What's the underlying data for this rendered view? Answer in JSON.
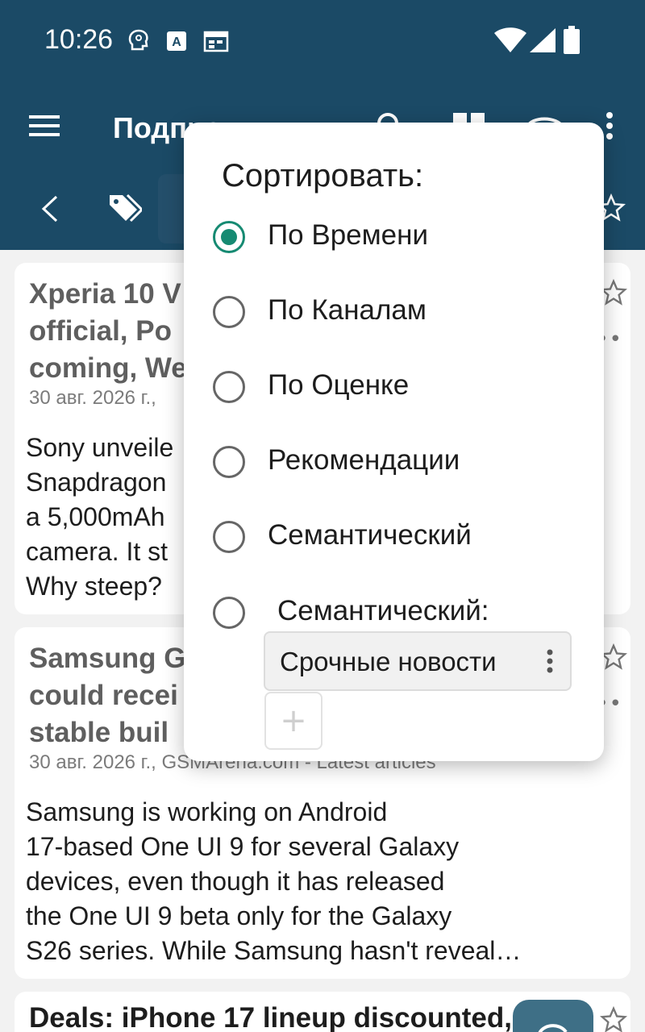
{
  "status_bar": {
    "time": "10:26"
  },
  "toolbar": {
    "title": "Подписки"
  },
  "colors": {
    "header_bg": "#1b4a66",
    "accent": "#168a72",
    "card_bg": "#ffffff"
  },
  "cards": [
    {
      "title_lines": [
        "Xperia 10 V",
        "official, Po",
        "coming, We"
      ],
      "meta": "30 авг. 2026 г.,",
      "body_lines": [
        "Sony unveile",
        "Snapdragon",
        "a 5,000mAh",
        "camera. It st",
        "Why steep?"
      ]
    },
    {
      "title_lines": [
        "Samsung G",
        "could recei",
        "stable buil"
      ],
      "meta": "30 авг. 2026 г., GSMArena.com - Latest articles",
      "body_lines": [
        "Samsung is working on Android",
        "17-based One UI 9 for several Galaxy",
        "devices, even though it has released",
        "the One UI 9 beta only for the Galaxy",
        "S26 series. While Samsung hasn't reveal…"
      ]
    },
    {
      "title_lines": [
        "Deals: iPhone 17 lineup discounted,"
      ]
    }
  ],
  "sort_dialog": {
    "title": "Сортировать:",
    "options": [
      {
        "label": "По Времени",
        "checked": true
      },
      {
        "label": "По Каналам",
        "checked": false
      },
      {
        "label": "По Оценке",
        "checked": false
      },
      {
        "label": "Рекомендации",
        "checked": false
      },
      {
        "label": "Семантический",
        "checked": false
      },
      {
        "label": "Семантический:",
        "checked": false
      }
    ],
    "chip_label": "Срочные новости",
    "add_label": "+"
  }
}
